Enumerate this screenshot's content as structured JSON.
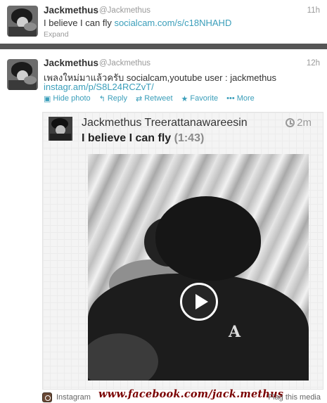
{
  "tweet1": {
    "name": "Jackmethus",
    "handle": "@Jackmethus",
    "time": "11h",
    "text": "I believe I can fly ",
    "link": "socialcam.com/s/c18NHAHD",
    "expand": "Expand"
  },
  "tweet2": {
    "name": "Jackmethus",
    "handle": "@Jackmethus",
    "time": "12h",
    "text": "เพลงใหม่มาแล้วครับ socialcam,youtube user : jackmethus",
    "link": "instagr.am/p/S8L24RCZvT/",
    "actions": {
      "hide_photo": "Hide photo",
      "reply": "Reply",
      "retweet": "Retweet",
      "favorite": "Favorite",
      "more": "More"
    },
    "action_icons": [
      "photo-icon",
      "reply-icon",
      "retweet-icon",
      "star-icon",
      "more-icon"
    ],
    "card": {
      "author": "Jackmethus Treerattanawareesin",
      "title": "I believe I can fly",
      "duration": "(1:43)",
      "time": "2m"
    },
    "footer": {
      "instagram": "Instagram",
      "watermark": "www.facebook.com/jack.methus",
      "flag": "Flag this media"
    }
  },
  "colors": {
    "link": "#3a9eba",
    "divider": "#555555",
    "watermark": "#7a0000"
  }
}
